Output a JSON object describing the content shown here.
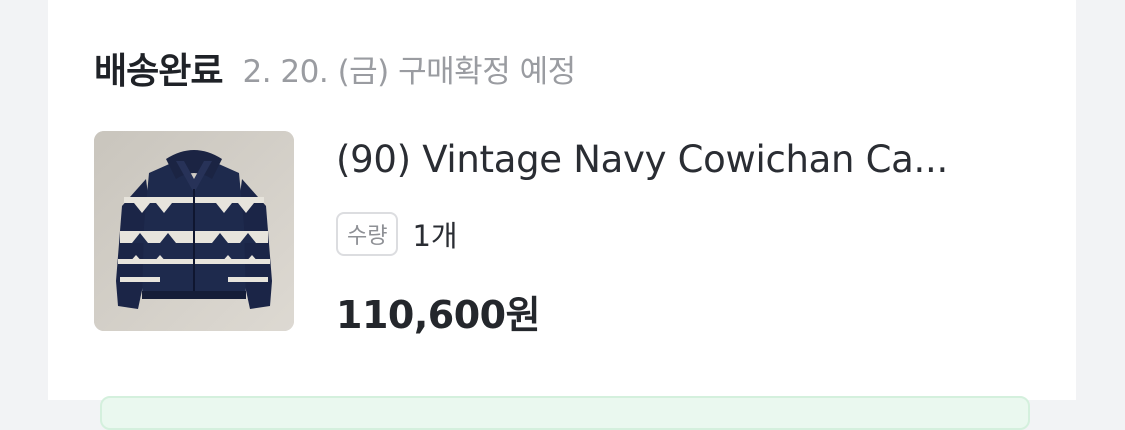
{
  "order": {
    "status": "배송완료",
    "confirm_note": "2. 20. (금) 구매확정 예정",
    "product": {
      "image_icon": "navy-cowichan-cardigan-photo",
      "name": "(90) Vintage Navy Cowichan Ca...",
      "quantity_label": "수량",
      "quantity_value": "1개",
      "price": "110,600원"
    }
  },
  "colors": {
    "background": "#f2f3f5",
    "card": "#ffffff",
    "title_text": "#1f2227",
    "muted_text": "#9a9ca1",
    "chip_border": "#dcdde0",
    "green_panel": "#eaf8ef"
  }
}
